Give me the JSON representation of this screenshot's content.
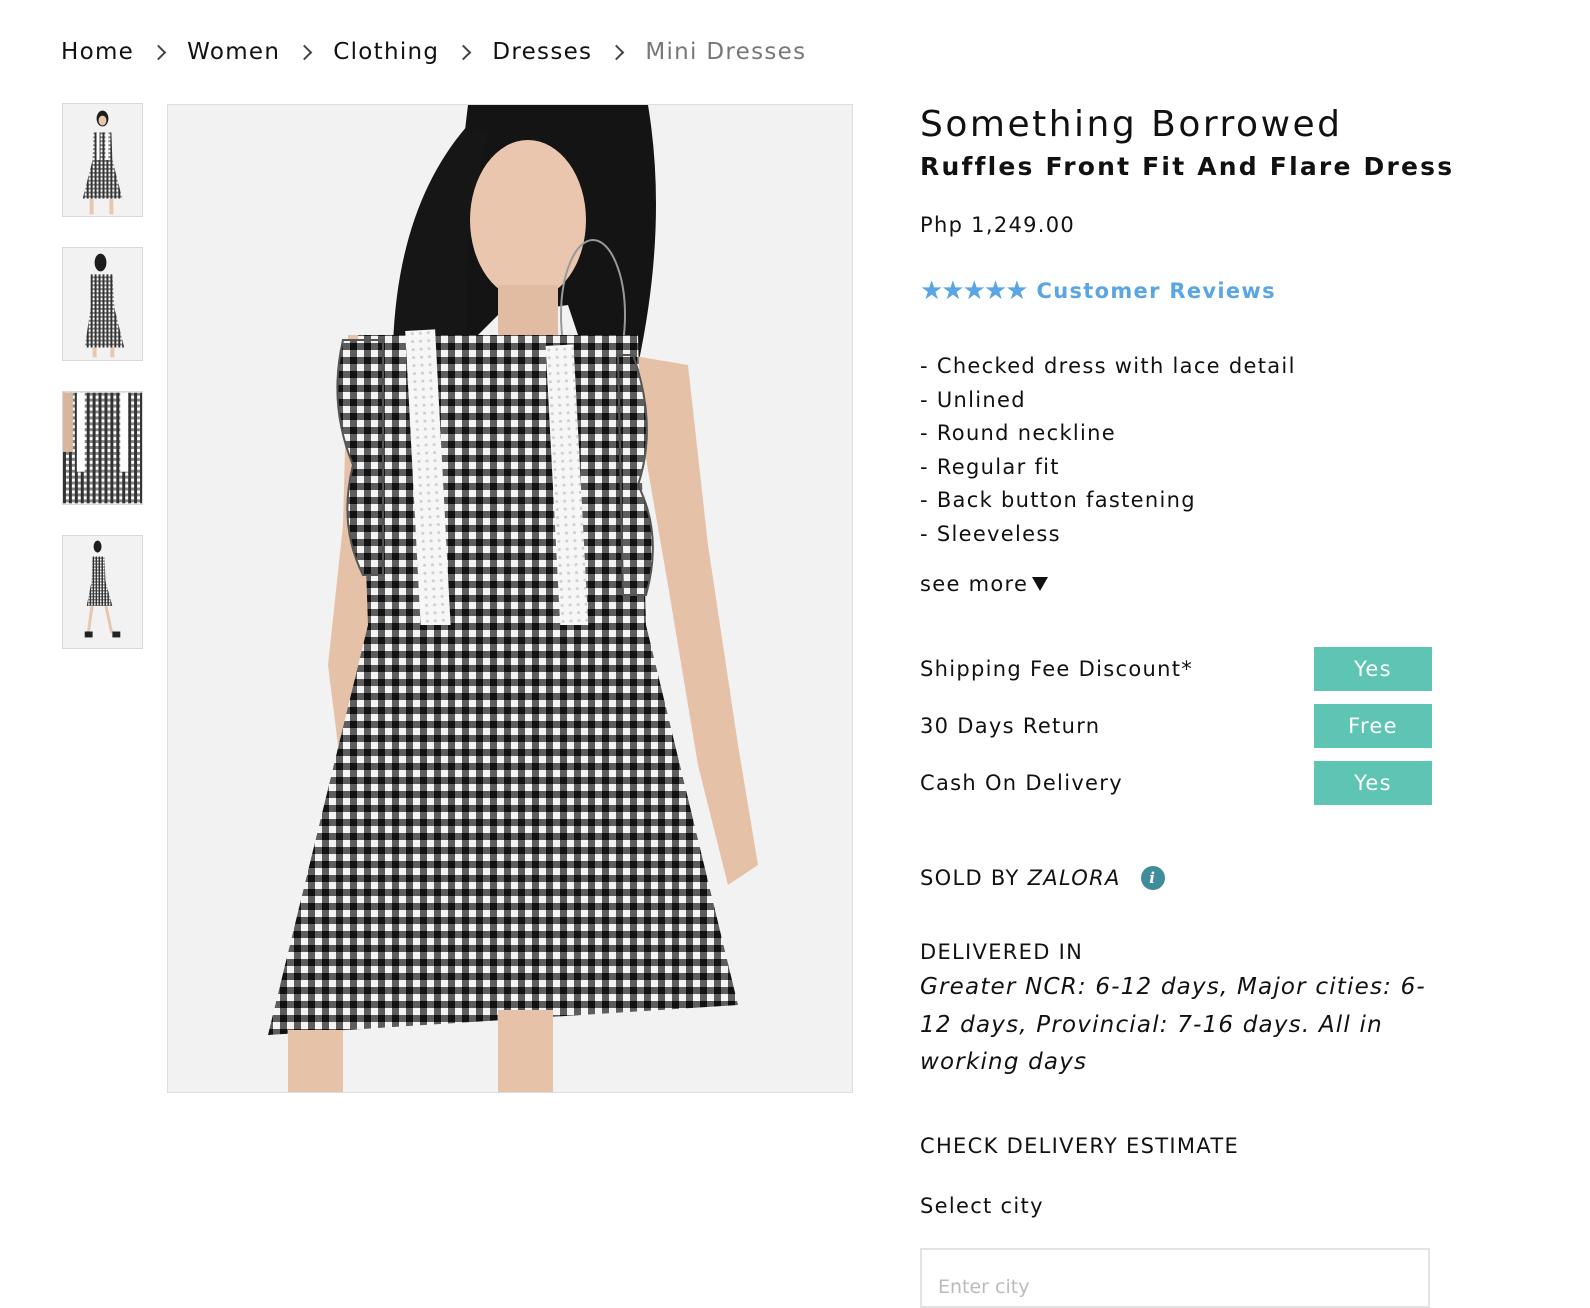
{
  "breadcrumb": {
    "items": [
      "Home",
      "Women",
      "Clothing",
      "Dresses"
    ],
    "current": "Mini Dresses"
  },
  "gallery": {
    "thumbnail_count": 4,
    "selected_index": 0
  },
  "product": {
    "brand": "Something Borrowed",
    "name": "Ruffles Front Fit And Flare Dress",
    "price": "Php 1,249.00",
    "rating_stars": "★★★★★",
    "reviews_label": "Customer Reviews",
    "description": [
      "- Checked dress with lace detail",
      "- Unlined",
      "- Round neckline",
      "- Regular fit",
      "- Back button fastening",
      "- Sleeveless"
    ],
    "see_more": "see more"
  },
  "features": [
    {
      "label": "Shipping Fee Discount*",
      "value": "Yes"
    },
    {
      "label": "30 Days Return",
      "value": "Free"
    },
    {
      "label": "Cash On Delivery",
      "value": "Yes"
    }
  ],
  "seller": {
    "prefix": "SOLD BY",
    "name": "ZALORA",
    "info_icon": "i"
  },
  "delivery": {
    "title": "DELIVERED IN",
    "text": "Greater NCR: 6-12 days, Major cities: 6-12 days, Provincial: 7-16 days. All in working days"
  },
  "delivery_estimate": {
    "title": "CHECK DELIVERY ESTIMATE",
    "city_label": "Select city",
    "city_placeholder": "Enter city",
    "city_value": ""
  },
  "colors": {
    "accent_blue": "#5aa6e4",
    "badge_teal": "#5ec4b3",
    "info_teal": "#3f8d9a"
  }
}
